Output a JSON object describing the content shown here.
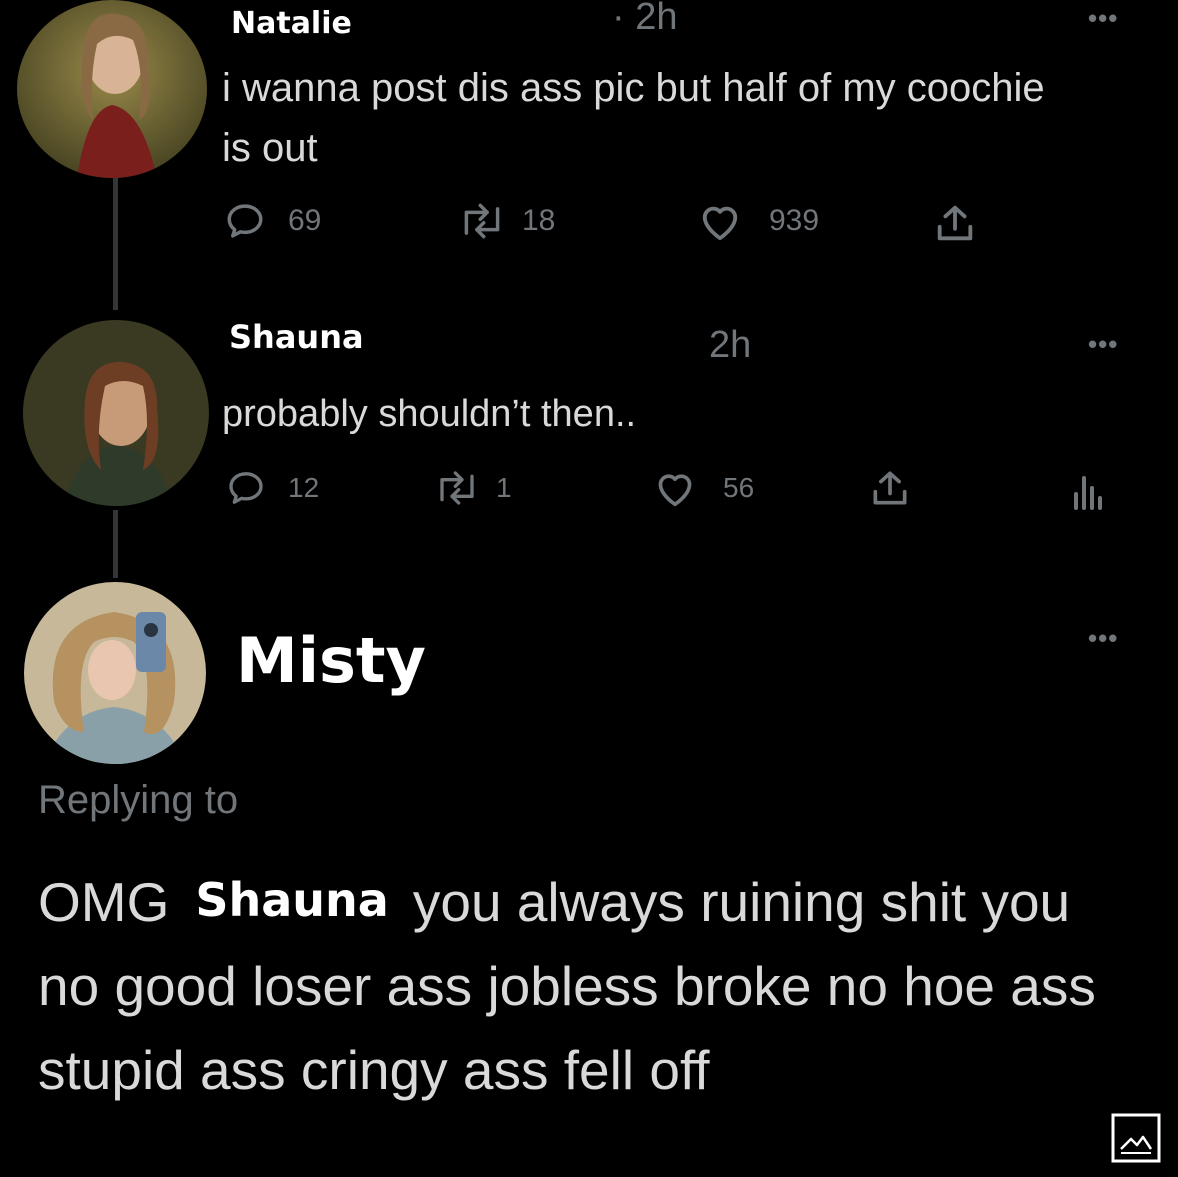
{
  "tweets": [
    {
      "author": "Natalie",
      "time": "· 2h",
      "text": "i wanna post dis ass pic but half of my coochie is out",
      "replies": "69",
      "retweets": "18",
      "likes": "939"
    },
    {
      "author": "Shauna",
      "time": "2h",
      "text": "probably shouldn’t then..",
      "replies": "12",
      "retweets": "1",
      "likes": "56"
    }
  ],
  "reply": {
    "author": "Misty",
    "replying_to_label": "Replying to",
    "prefix": "OMG",
    "mention": "Shauna",
    "text": "you always ruining shit you no good loser ass jobless broke no hoe ass stupid ass cringy ass fell off"
  },
  "more_label": "•••",
  "colors": {
    "background": "#000000",
    "secondary_text": "#71767b",
    "body_text": "#d9d9d9",
    "name_text": "#ffffff"
  },
  "icons": [
    "reply-icon",
    "retweet-icon",
    "like-icon",
    "share-icon",
    "analytics-icon",
    "media-icon"
  ]
}
